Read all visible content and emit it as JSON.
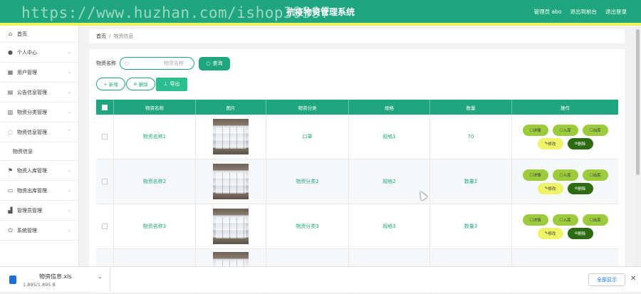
{
  "header": {
    "watermark": "https://www.huzhan.com/ishop39397",
    "title": "抗疫物资管理系统",
    "user": "管理员 abo",
    "to_front": "退出到前台",
    "logout": "退出登录",
    "colors": {
      "primary": "#1fa67f",
      "stripe": "#e9f35a"
    }
  },
  "sidebar": {
    "items": [
      {
        "label": "首页",
        "icon": "home-icon"
      },
      {
        "label": "个人中心",
        "icon": "user-icon"
      },
      {
        "label": "用户管理",
        "icon": "users-icon"
      },
      {
        "label": "公告信息管理",
        "icon": "notice-icon"
      },
      {
        "label": "物资分类管理",
        "icon": "category-icon"
      },
      {
        "label": "物资信息管理",
        "icon": "info-icon",
        "expanded": true
      },
      {
        "label": "物资信息",
        "sub": true
      },
      {
        "label": "物资入库管理",
        "icon": "flag-icon"
      },
      {
        "label": "物资出库管理",
        "icon": "outbound-icon"
      },
      {
        "label": "管理员管理",
        "icon": "admin-icon"
      },
      {
        "label": "系统管理",
        "icon": "system-icon"
      }
    ]
  },
  "breadcrumb": {
    "home": "首页",
    "separator": "/",
    "current": "物资信息"
  },
  "search": {
    "label": "物资名称",
    "placeholder": "物资名称",
    "query_button": "查询"
  },
  "actions": {
    "add": "+ 新增",
    "delete": "删除",
    "export": "导出"
  },
  "table": {
    "columns": [
      "物资名称",
      "图片",
      "物资分类",
      "规格",
      "数量",
      "操作"
    ],
    "rows": [
      {
        "name": "物资名称1",
        "category": "口罩",
        "spec": "规格1",
        "qty": "70"
      },
      {
        "name": "物资名称2",
        "category": "物资分类2",
        "spec": "规格2",
        "qty": "数量2"
      },
      {
        "name": "物资名称3",
        "category": "物资分类3",
        "spec": "规格3",
        "qty": "数量3"
      }
    ],
    "ops": {
      "detail": "详情",
      "inbound": "入库",
      "outbound": "出库",
      "edit": "修改",
      "delete": "删除"
    }
  },
  "download": {
    "filename": "物资信息.xls",
    "size": "1.895/1.895 B",
    "show_all": "全部显示"
  }
}
